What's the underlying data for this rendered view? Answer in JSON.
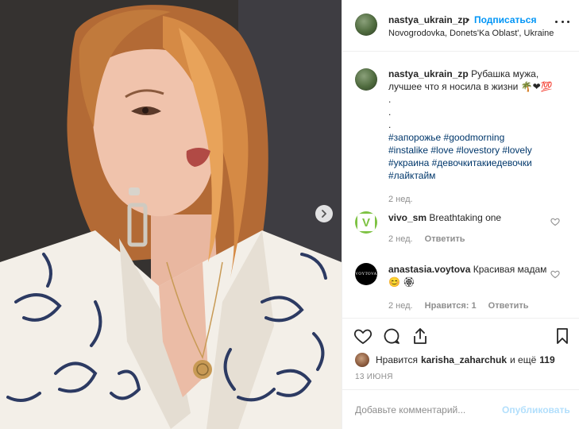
{
  "post": {
    "username": "nastya_ukrain_zp",
    "separator": "•",
    "follow_label": "Подписаться",
    "location": "Novogrodovka, Donets'Ka Oblast', Ukraine",
    "more_icon": "more-horizontal-icon"
  },
  "caption": {
    "username": "nastya_ukrain_zp",
    "text": "Рубашка мужа, лучшее что я носила в жизни 🌴❤💯",
    "dots": [
      ".",
      ".",
      "."
    ],
    "hashtags": [
      "#запорожье #goodmorning",
      "#instalike #love #lovestory #lovely",
      "#украина #девочкитакиедевочки",
      "#лайктайм"
    ],
    "time": "2 нед."
  },
  "comments": [
    {
      "username": "vivo_sm",
      "text": "Breathtaking one",
      "time": "2 нед.",
      "reply_label": "Ответить",
      "likes_label": "",
      "avatar_text": "V",
      "avatar_color": "#7dc242"
    },
    {
      "username": "anastasia.voytova",
      "text": "Красивая мадам😊 🏵",
      "time": "2 нед.",
      "reply_label": "Ответить",
      "likes_label": "Нравится: 1",
      "avatar_text": "VOYTOVA",
      "avatar_color": "#000000"
    }
  ],
  "actions": {
    "icons": [
      "heart-icon",
      "comment-icon",
      "share-icon",
      "bookmark-icon"
    ]
  },
  "likes": {
    "prefix": "Нравится",
    "user": "karisha_zaharchuk",
    "middle": "и ещё",
    "count": "119"
  },
  "date": "13 ИЮНЯ",
  "add_comment": {
    "placeholder": "Добавьте комментарий...",
    "publish_label": "Опубликовать"
  },
  "colors": {
    "accent": "#0095f6",
    "hashtag": "#00376b",
    "muted": "#8e8e8e",
    "publish_disabled": "#b2dffc"
  }
}
